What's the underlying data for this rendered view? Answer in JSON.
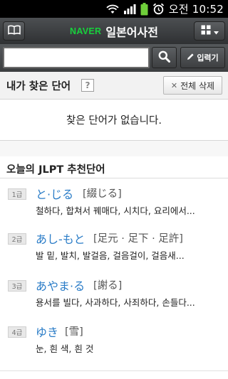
{
  "status_bar": {
    "ampm": "오전",
    "time": "10:52"
  },
  "header": {
    "brand": "NAVER",
    "title": "일본어사전"
  },
  "search": {
    "placeholder": "",
    "input_button_label": "입력기"
  },
  "history": {
    "title": "내가 찾은 단어",
    "help_label": "?",
    "clear_label": "전체 삭제",
    "empty_message": "찾은 단어가 없습니다."
  },
  "recommend": {
    "title": "오늘의 JLPT 추천단어",
    "words": [
      {
        "level": "1급",
        "kana": "と·じる",
        "kanji": "[綴じる]",
        "meaning": "철하다, 합쳐서 꿰매다, 시치다, 요리에서..."
      },
      {
        "level": "2급",
        "kana": "あし-もと",
        "kanji": "[足元 · 足下 · 足許]",
        "meaning": "발 밑, 발치, 발걸음, 걸음걸이, 걸음새..."
      },
      {
        "level": "3급",
        "kana": "あやま·る",
        "kanji": "[謝る]",
        "meaning": "용서를 빌다, 사과하다, 사죄하다, 손들다..."
      },
      {
        "level": "4급",
        "kana": "ゆき",
        "kanji": "[雪]",
        "meaning": "눈, 흰 색, 흰 것"
      }
    ]
  },
  "colors": {
    "brand_green": "#17d13c",
    "kana_blue": "#2a7cc7",
    "toolbar_dark": "#3c3e40"
  }
}
